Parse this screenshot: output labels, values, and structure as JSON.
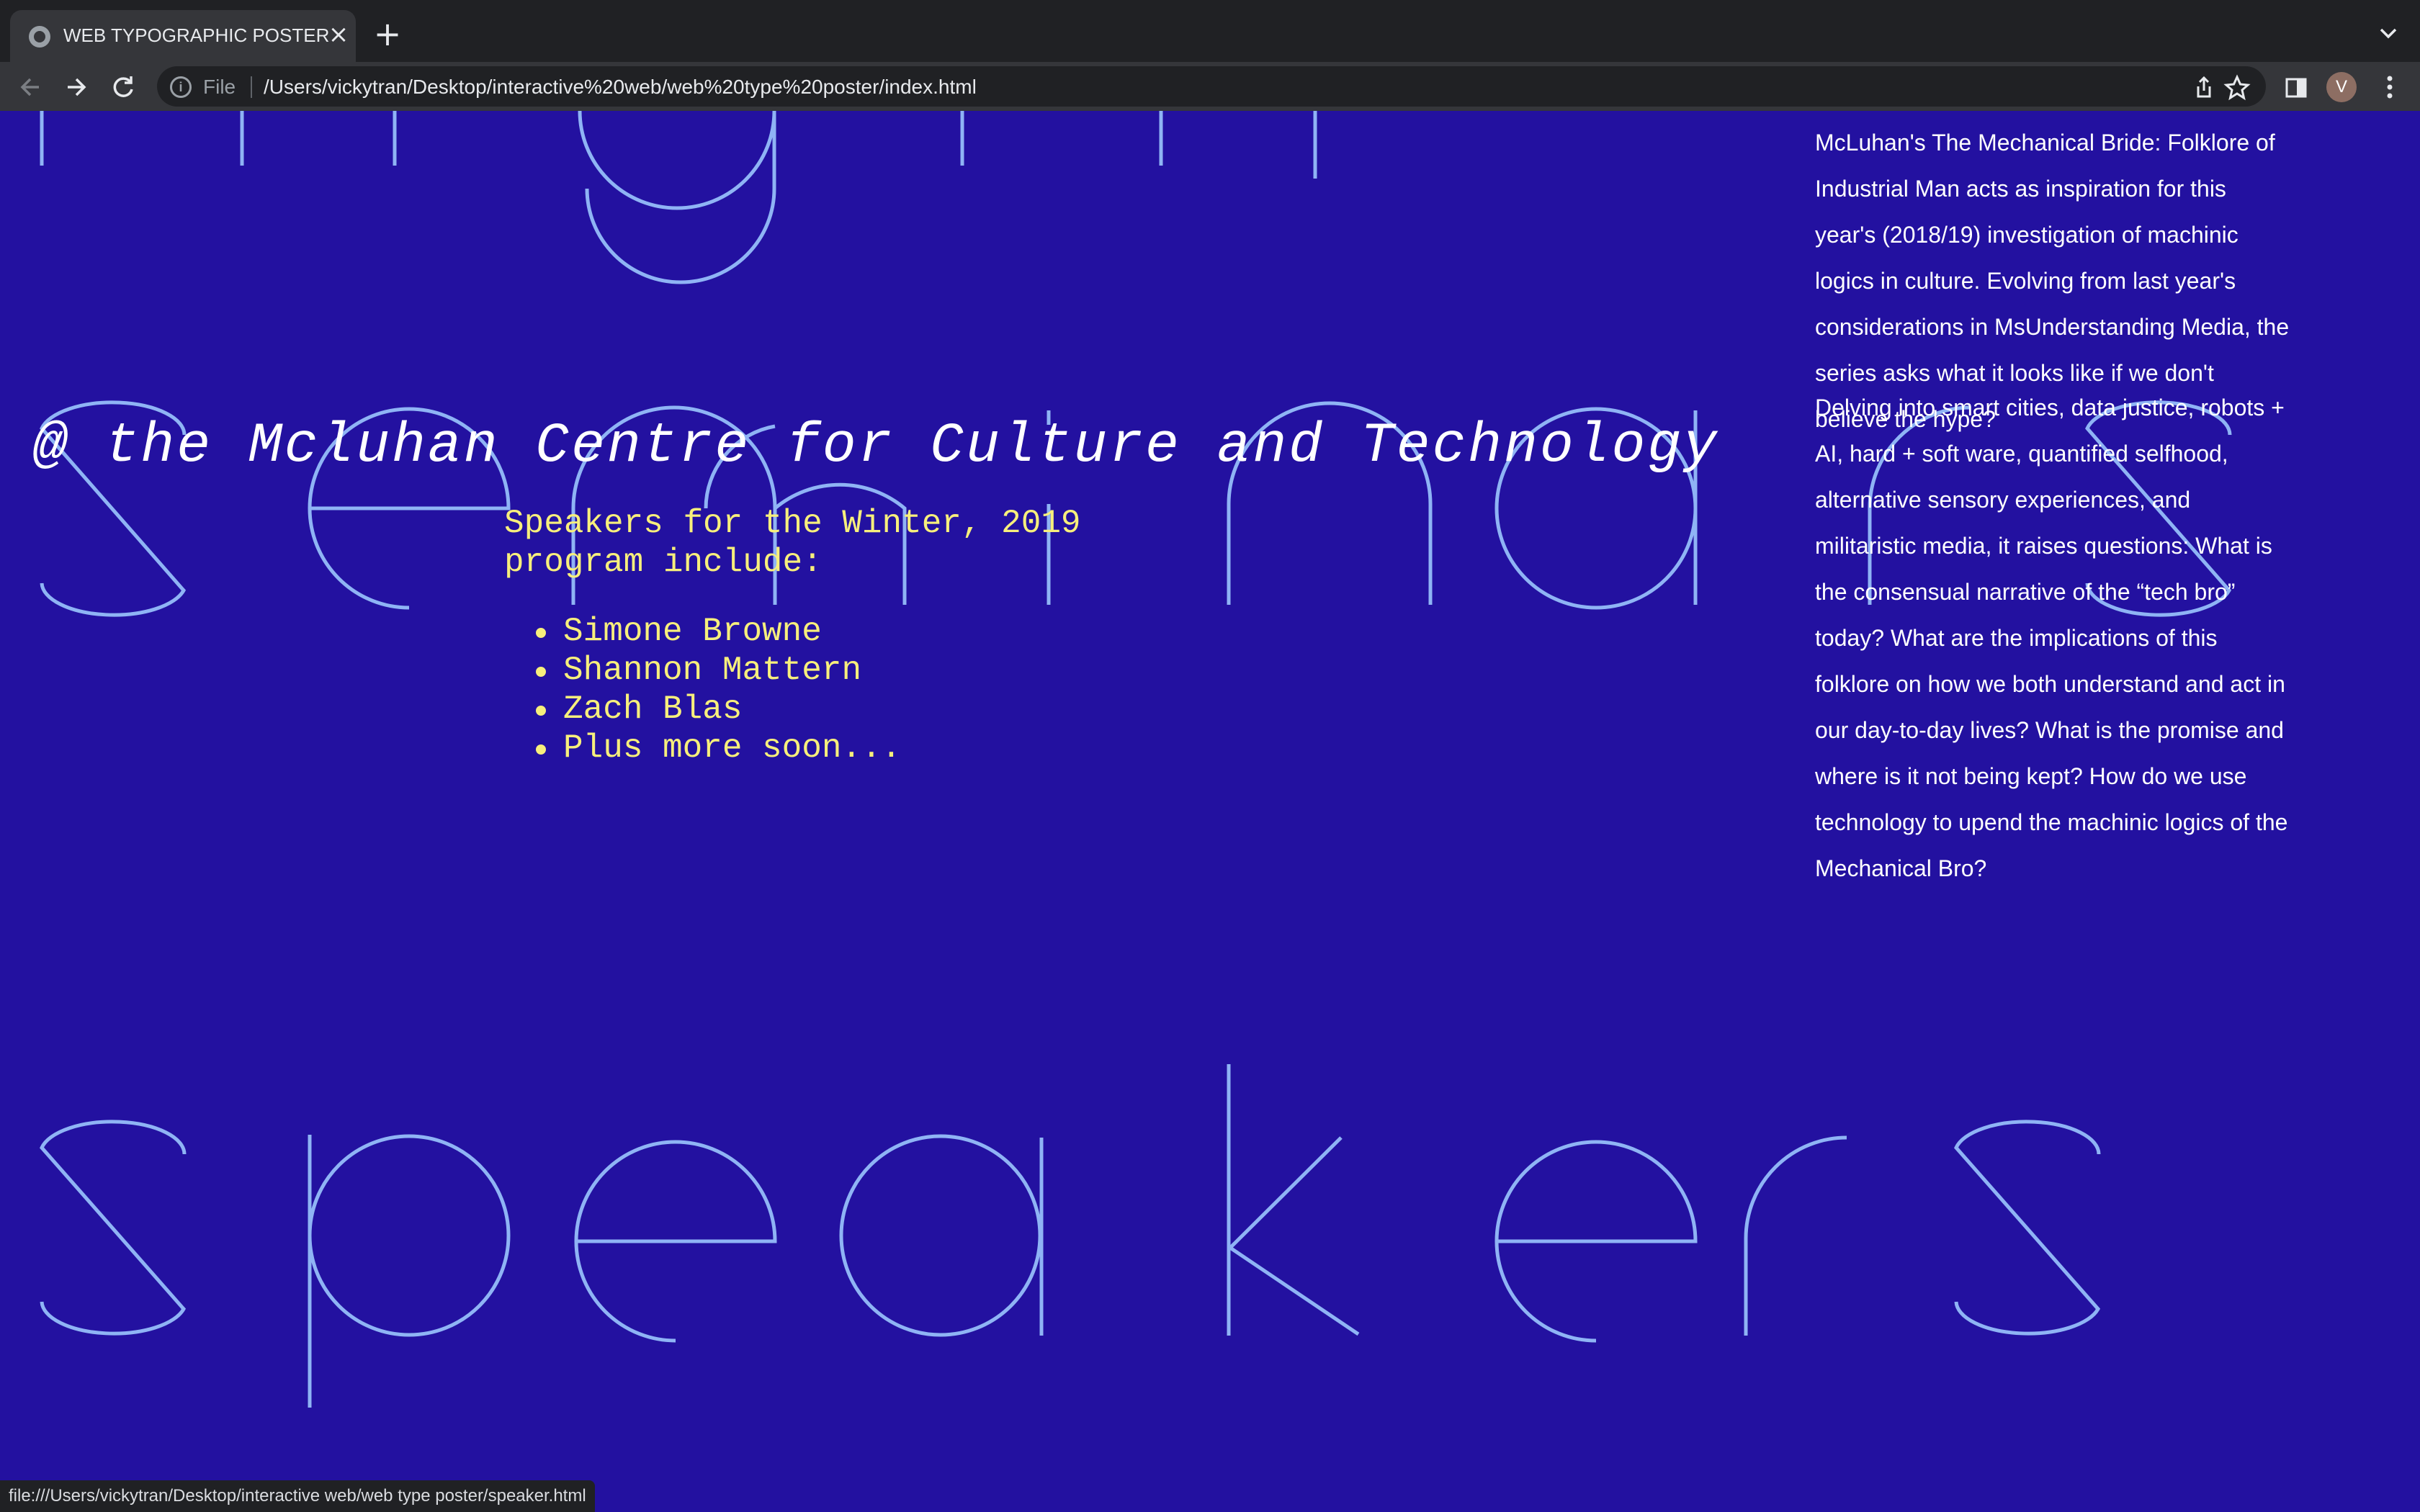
{
  "browser": {
    "tab_title": "WEB TYPOGRAPHIC POSTER",
    "tab_close": "×",
    "new_tab": "+",
    "scheme_label": "File",
    "url": "/Users/vickytran/Desktop/interactive%20web/web%20type%20poster/index.html",
    "avatar_initial": "V",
    "status_url": "file:///Users/vickytran/Desktop/interactive web/web type poster/speaker.html"
  },
  "poster": {
    "display_words": [
      "seminars",
      "speakers"
    ],
    "venue": "@ the Mcluhan Centre for Culture and Technology",
    "speakers_intro": "Speakers for the Winter, 2019 program include:",
    "speakers": [
      "Simone Browne",
      "Shannon Mattern",
      "Zach Blas",
      "Plus more soon..."
    ],
    "paragraph_1": "McLuhan's The Mechanical Bride: Folklore of Industrial Man acts as inspiration for this year's (2018/19) investigation of machinic logics in culture. Evolving from last year's considerations in MsUnderstanding Media, the series asks what it looks like if we don't believe the hype?",
    "paragraph_2": "Delving into smart cities, data justice, robots + AI, hard + soft ware, quantified selfhood, alternative sensory experiences, and militaristic media, it raises questions: What is the consensual narrative of the “tech bro” today? What are the implications of this folklore on how we both understand and act in our day-to-day lives? What is the promise and where is it not being kept? How do we use technology to upend the machinic logics of the Mechanical Bro?"
  },
  "colors": {
    "background": "#2311a0",
    "letter_stroke": "#8fb4f5",
    "speakers_text": "#f7ef7c",
    "body_text": "#ffffff"
  }
}
